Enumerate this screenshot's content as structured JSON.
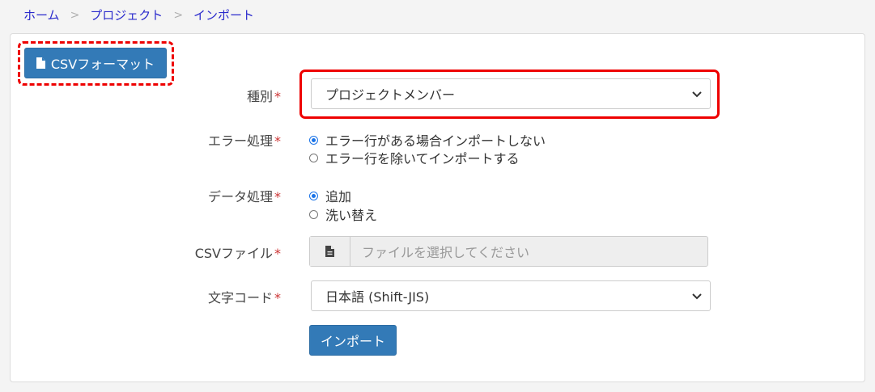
{
  "breadcrumb": {
    "home": "ホーム",
    "project": "プロジェクト",
    "current": "インポート",
    "sep": ">"
  },
  "toolbar": {
    "csv_format_label": "CSVフォーマット"
  },
  "form": {
    "required_mark": "*",
    "type": {
      "label": "種別",
      "value": "プロジェクトメンバー"
    },
    "error_handling": {
      "label": "エラー処理",
      "options": [
        "エラー行がある場合インポートしない",
        "エラー行を除いてインポートする"
      ],
      "selected_index": 0
    },
    "data_handling": {
      "label": "データ処理",
      "options": [
        "追加",
        "洗い替え"
      ],
      "selected_index": 0
    },
    "csv_file": {
      "label": "CSVファイル",
      "placeholder": "ファイルを選択してください"
    },
    "encoding": {
      "label": "文字コード",
      "value": "日本語 (Shift-JIS)"
    },
    "submit_label": "インポート"
  },
  "colors": {
    "primary": "#337ab7",
    "link": "#2a2acc",
    "highlight": "#ee0000",
    "required": "#cc3333",
    "radio": "#1a73e8"
  }
}
